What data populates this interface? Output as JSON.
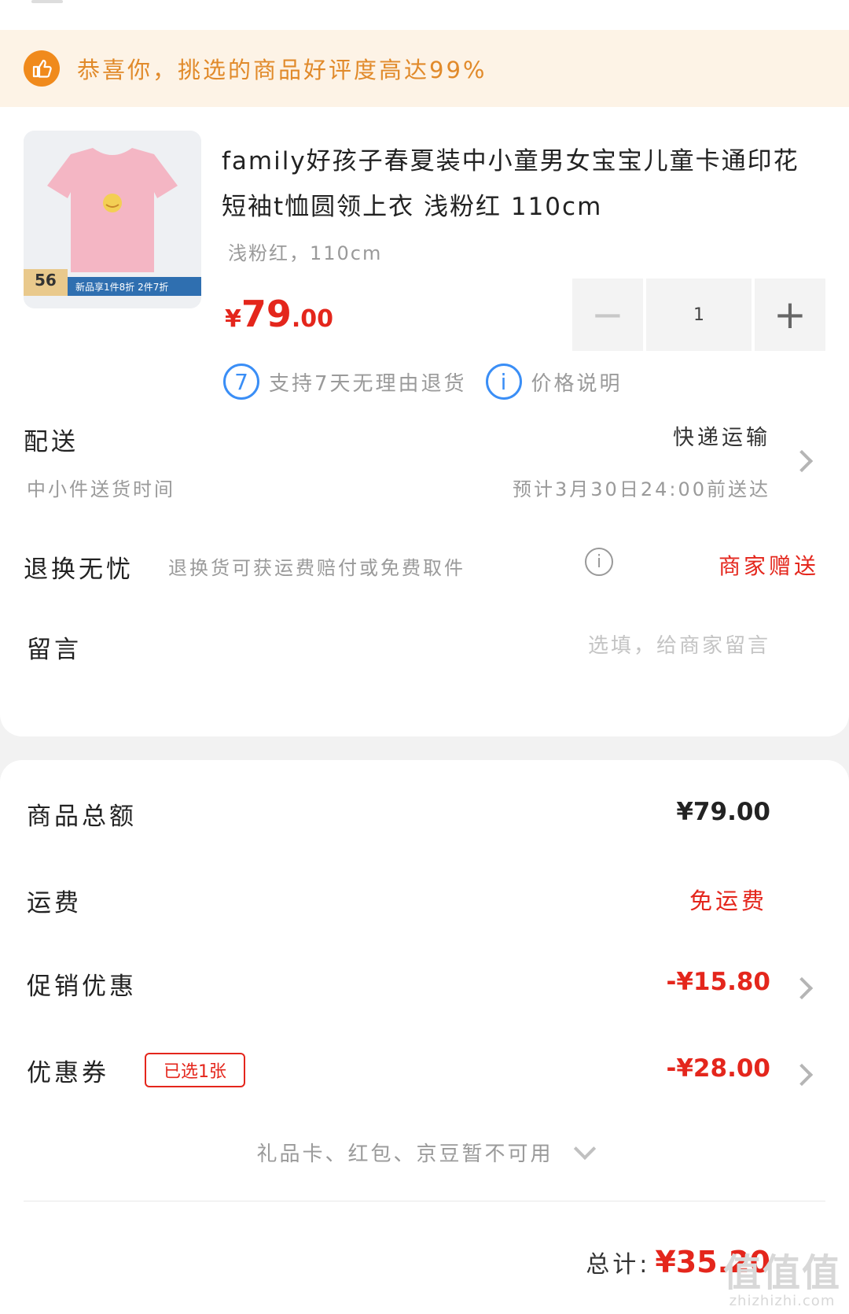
{
  "banner": {
    "text": "恭喜你，挑选的商品好评度高达99%",
    "icon": "thumbs-up-icon",
    "accent_color": "#f08a1c"
  },
  "product": {
    "title": "family好孩子春夏装中小童男女宝宝儿童卡通印花短袖t恤圆领上衣 浅粉红 110cm",
    "spec": "浅粉红，110cm",
    "price_symbol": "¥",
    "price_int": "79",
    "price_dec": ".00",
    "image_badge": "56",
    "image_banner": "新品享1件8折 2件7折",
    "quantity": "1",
    "minus_label": "−",
    "plus_label": "+"
  },
  "service": {
    "return_icon_text": "7",
    "return_text": "支持7天无理由退货",
    "price_icon_text": "i",
    "price_text": "价格说明"
  },
  "delivery": {
    "label": "配送",
    "method": "快递运输",
    "sub_label": "中小件送货时间",
    "eta": "预计3月30日24:00前送达"
  },
  "return_worry_free": {
    "label": "退换无忧",
    "desc": "退换货可获运费赔付或免费取件",
    "tag": "商家赠送"
  },
  "message": {
    "label": "留言",
    "placeholder": "选填，给商家留言"
  },
  "summary": {
    "goods_total_label": "商品总额",
    "goods_total": "¥79.00",
    "shipping_label": "运费",
    "shipping_value": "免运费",
    "promo_label": "促销优惠",
    "promo_value": "-¥15.80",
    "coupon_label": "优惠券",
    "coupon_tag": "已选1张",
    "coupon_value": "-¥28.00",
    "gift_note": "礼品卡、红包、京豆暂不可用",
    "total_label": "总计:",
    "total_value": "¥35.20"
  },
  "watermark": {
    "big": "值值值",
    "small": "zhizhizhi.com"
  },
  "colors": {
    "price_red": "#e4261c",
    "info_blue": "#3a8ef6",
    "banner_bg": "#fdf3e6"
  }
}
